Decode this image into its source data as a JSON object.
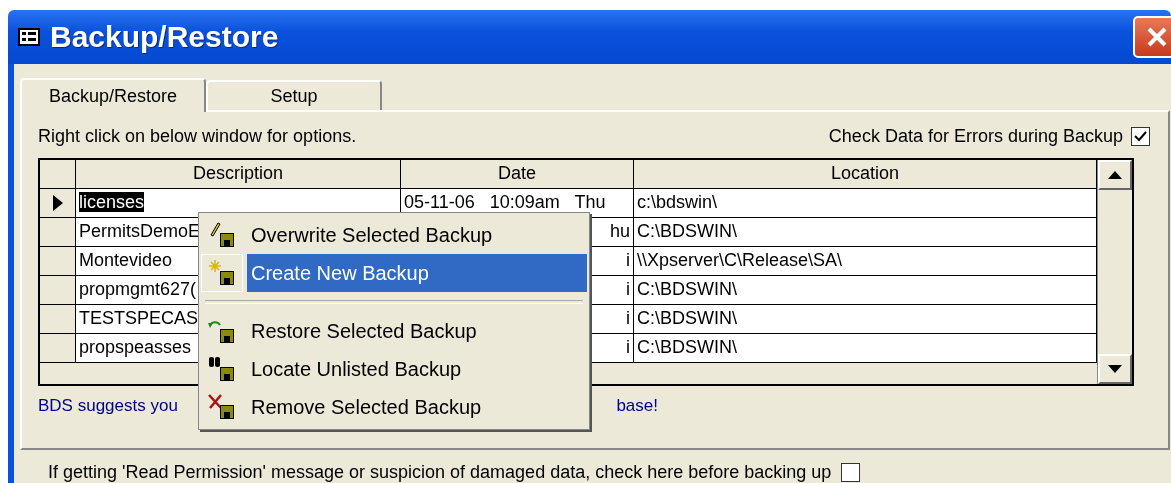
{
  "window": {
    "title": "Backup/Restore"
  },
  "tabs": [
    {
      "label": "Backup/Restore",
      "selected": true
    },
    {
      "label": "Setup",
      "selected": false
    }
  ],
  "hint": "Right click on below window for options.",
  "check_errors": {
    "label": "Check Data for Errors during Backup",
    "checked": true
  },
  "table": {
    "columns": [
      "Description",
      "Date",
      "Location"
    ],
    "rows": [
      {
        "description": "licenses",
        "date": "05-11-06   10:09am   Thu",
        "location": "c:\\bdswin\\",
        "selected": true
      },
      {
        "description": "PermitsDemoE",
        "date": "hu",
        "location": "C:\\BDSWIN\\",
        "selected": false
      },
      {
        "description": "Montevideo",
        "date": "i",
        "location": "\\\\Xpserver\\C\\Release\\SA\\",
        "selected": false
      },
      {
        "description": "propmgmt627(",
        "date": "i",
        "location": "C:\\BDSWIN\\",
        "selected": false
      },
      {
        "description": "TESTSPECAS",
        "date": "i",
        "location": "C:\\BDSWIN\\",
        "selected": false
      },
      {
        "description": "propspeasses",
        "date": "i",
        "location": "C:\\BDSWIN\\",
        "selected": false
      }
    ]
  },
  "notice": [
    "BDS suggests you",
    "base!"
  ],
  "context_menu": [
    {
      "kind": "item",
      "label": "Overwrite Selected Backup",
      "selected": false
    },
    {
      "kind": "item",
      "label": "Create New Backup",
      "selected": true
    },
    {
      "kind": "separator"
    },
    {
      "kind": "item",
      "label": "Restore Selected Backup",
      "selected": false
    },
    {
      "kind": "item",
      "label": "Locate Unlisted Backup",
      "selected": false
    },
    {
      "kind": "item",
      "label": "Remove Selected Backup",
      "selected": false
    }
  ],
  "read_permission": {
    "label": "If getting 'Read Permission' message or suspicion of damaged data, check here before backing up",
    "checked": false
  }
}
